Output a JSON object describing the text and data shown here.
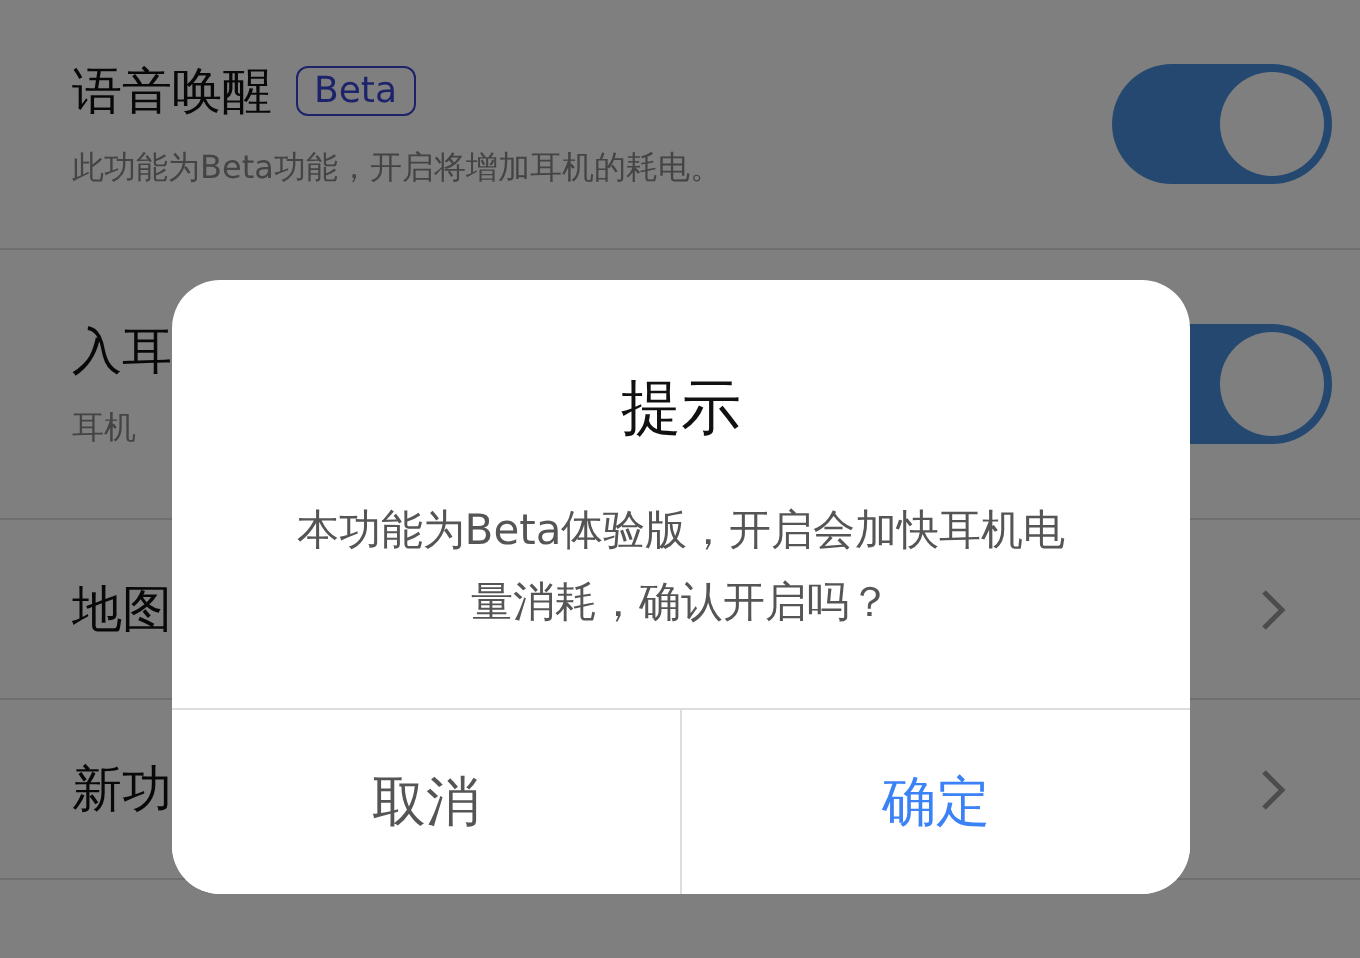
{
  "settings": [
    {
      "kind": "toggle",
      "title": "语音唤醒",
      "badge": "Beta",
      "subtitle": "此功能为Beta功能，开启将增加耳机的耗电。",
      "on": true
    },
    {
      "kind": "toggle",
      "title": "入耳",
      "subtitle": "耳机",
      "on": true
    },
    {
      "kind": "link",
      "title": "地图"
    },
    {
      "kind": "link",
      "title": "新功"
    }
  ],
  "dialog": {
    "title": "提示",
    "message": "本功能为Beta体验版，开启会加快耳机电量消耗，确认开启吗？",
    "buttons": [
      {
        "label": "取消",
        "kind": "cancel"
      },
      {
        "label": "确定",
        "kind": "confirm"
      }
    ]
  }
}
